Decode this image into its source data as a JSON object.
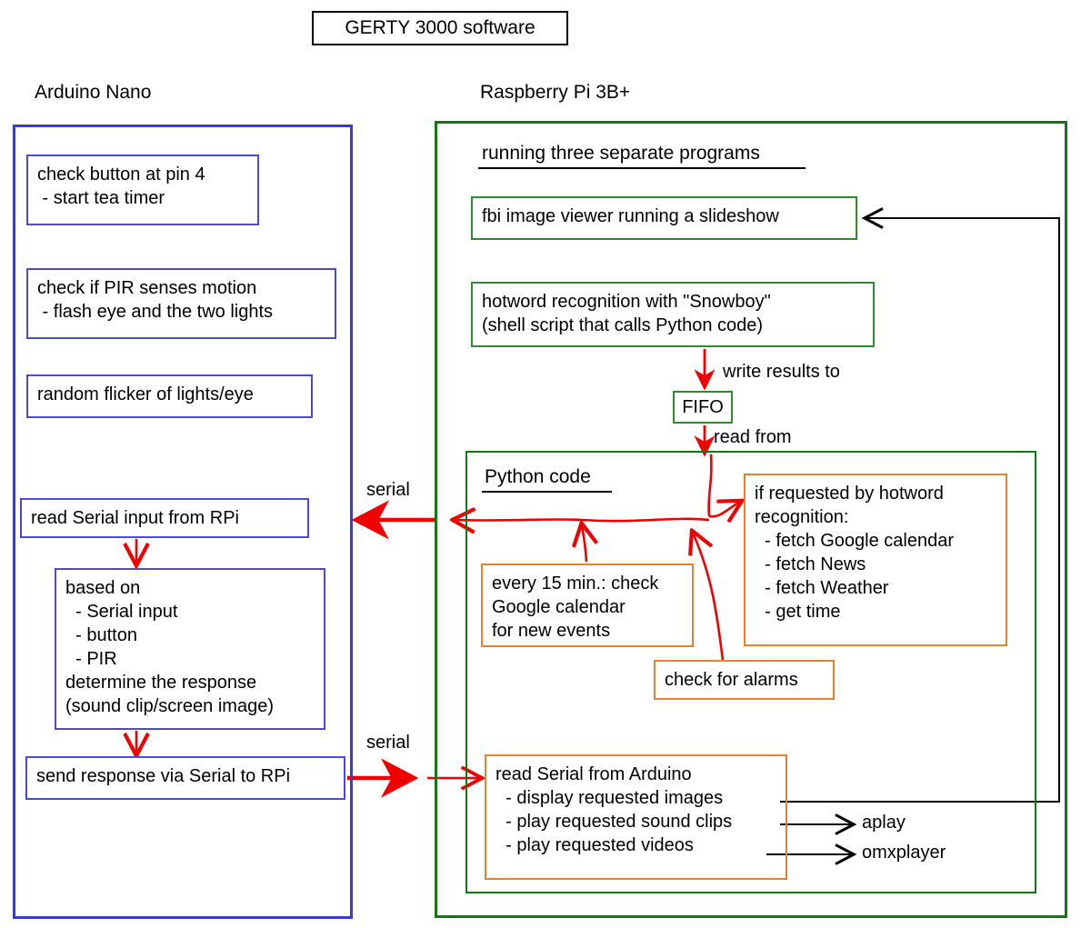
{
  "title": "GERTY 3000 software",
  "sections": {
    "arduino": {
      "heading": "Arduino Nano",
      "nodes": {
        "check_button": "check button at pin 4\n - start tea timer",
        "check_pir": "check if PIR senses motion\n - flash eye and the two lights",
        "random_flicker": "random flicker of lights/eye",
        "read_serial": "read Serial input from RPi",
        "based_on": "based on\n  - Serial input\n  - button\n  - PIR\ndetermine the response\n(sound clip/screen image)",
        "send_response": "send response via Serial to RPi"
      }
    },
    "raspberry_pi": {
      "heading": "Raspberry Pi 3B+",
      "subheading": "running three separate programs",
      "nodes": {
        "fbi": "fbi image viewer running a slideshow",
        "hotword": "hotword recognition with \"Snowboy\"\n(shell script that calls Python code)",
        "fifo": "FIFO"
      },
      "python": {
        "heading": "Python code",
        "nodes": {
          "hotword_request": "if requested by hotword\nrecognition:\n  - fetch Google calendar\n  - fetch News\n  - fetch Weather\n  - get time",
          "every_15_min": "every 15 min.: check\nGoogle calendar\nfor new events",
          "check_alarms": "check for alarms",
          "read_arduino": "read Serial from Arduino\n  - display requested images\n  - play requested sound clips\n  - play requested videos"
        }
      }
    }
  },
  "edge_labels": {
    "write_results_to": "write results to",
    "read_from": "read from",
    "serial_top": "serial",
    "serial_bottom": "serial"
  },
  "external_programs": {
    "aplay": "aplay",
    "omxplayer": "omxplayer"
  },
  "colors": {
    "arduino_border": "#3a3ad6",
    "rpi_border": "#107a10",
    "python_border": "#107a10",
    "node_blue": "#4a4ad6",
    "node_green": "#2e8b2e",
    "node_orange": "#e8822a",
    "red_arrow": "#f00000",
    "black_arrow": "#000000",
    "background": "#ffffff"
  }
}
